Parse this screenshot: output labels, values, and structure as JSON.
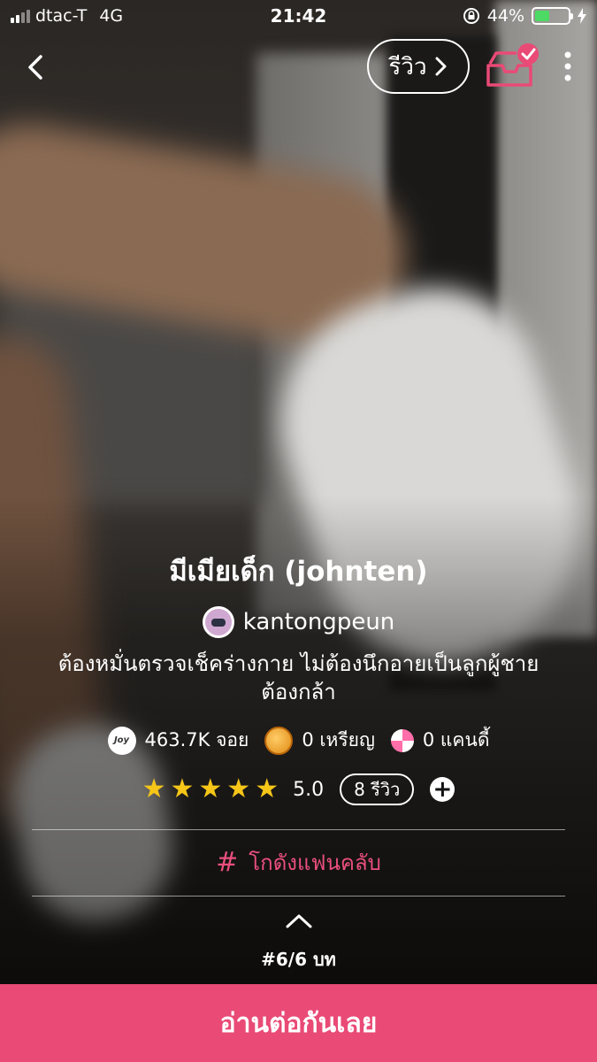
{
  "status_bar": {
    "carrier": "dtac-T",
    "network": "4G",
    "time": "21:42",
    "battery": "44%",
    "battery_level": 0.44
  },
  "nav": {
    "review_label": "รีวิว"
  },
  "story": {
    "title": "มีเมียเด็ก (johnten)",
    "author": "kantongpeun",
    "description_line1": "ต้องหมั่นตรวจเช็คร่างกาย ไม่ต้องนึกอายเป็นลูกผู้ชาย",
    "description_line2": "ต้องกล้า"
  },
  "stats": {
    "joy_icon_text": "Joy",
    "joy": "463.7K จอย",
    "coins": "0 เหรียญ",
    "candy": "0 แคนดี้"
  },
  "rating": {
    "stars": 5,
    "score": "5.0",
    "reviews": "8 รีวิว"
  },
  "fanclub": {
    "label": "โกดังแฟนคลับ"
  },
  "episode": "#6/6 บท",
  "cta": "อ่านต่อกันเลย",
  "colors": {
    "accent": "#e94a76",
    "star": "#f5c518",
    "battery": "#4cd964"
  },
  "icons": [
    "signal-icon",
    "back-icon",
    "chevron-right-icon",
    "inbox-check-icon",
    "more-vertical-icon",
    "joy-icon",
    "coin-icon",
    "candy-icon",
    "star-icon",
    "plus-icon",
    "hash-icon",
    "chevron-up-icon"
  ]
}
